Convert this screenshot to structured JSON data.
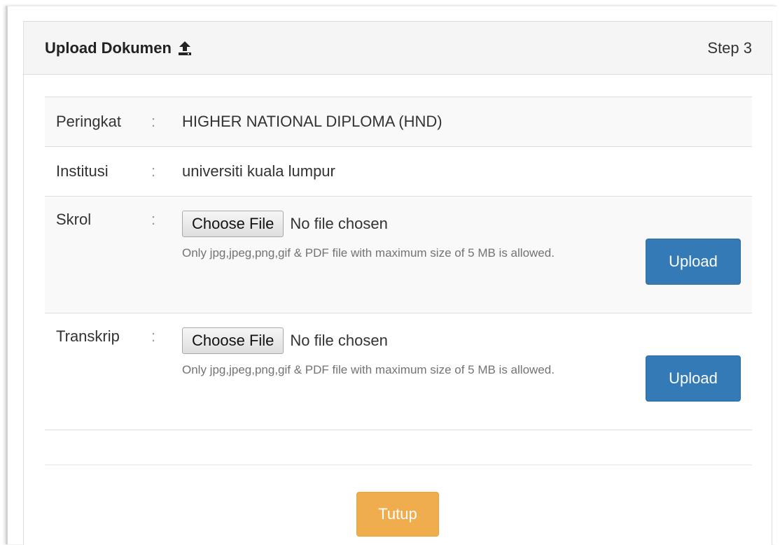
{
  "panel": {
    "title": "Upload Dokumen",
    "title_icon": "upload-icon",
    "step": "Step 3"
  },
  "rows": [
    {
      "label": "Peringkat",
      "colon": ":",
      "value": "HIGHER NATIONAL DIPLOMA (HND)"
    },
    {
      "label": "Institusi",
      "colon": ":",
      "value": "universiti kuala lumpur"
    },
    {
      "label": "Skrol",
      "colon": ":",
      "choose_label": "Choose File",
      "file_status": "No file chosen",
      "help": "Only jpg,jpeg,png,gif & PDF file with maximum size of 5 MB is allowed.",
      "upload_label": "Upload"
    },
    {
      "label": "Transkrip",
      "colon": ":",
      "choose_label": "Choose File",
      "file_status": "No file chosen",
      "help": "Only jpg,jpeg,png,gif & PDF file with maximum size of 5 MB is allowed.",
      "upload_label": "Upload"
    }
  ],
  "footer": {
    "close_label": "Tutup"
  },
  "colors": {
    "primary": "#337ab7",
    "warning": "#f0ad4e",
    "heading_bg": "#f5f5f5",
    "stripe_bg": "#f9f9f9"
  }
}
